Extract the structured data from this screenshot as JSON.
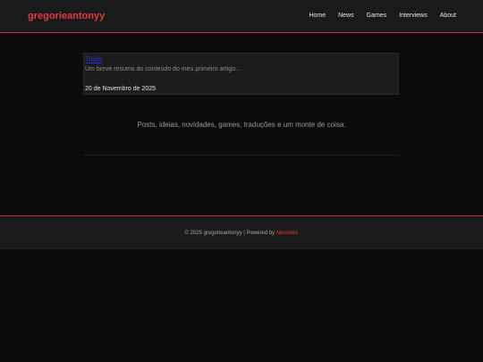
{
  "header": {
    "brand": "gregorieantonyy",
    "nav": [
      "Home",
      "News",
      "Games",
      "Interviews",
      "About"
    ]
  },
  "post": {
    "title": "Titulo",
    "summary": "Um breve resumo do conteúdo do meu primeiro artigo...",
    "date": "20 de Novembro de 2025"
  },
  "tagline": "Posts, ideias, novidades, games, traduções e um monte de coisa.",
  "footer": {
    "copyright": "© 2025 gregorieantonyy | Powered by ",
    "powered_link": "Neocities"
  },
  "colors": {
    "accent": "#e23b45",
    "background": "#0b0b0b",
    "panel": "#1a1a1a"
  }
}
